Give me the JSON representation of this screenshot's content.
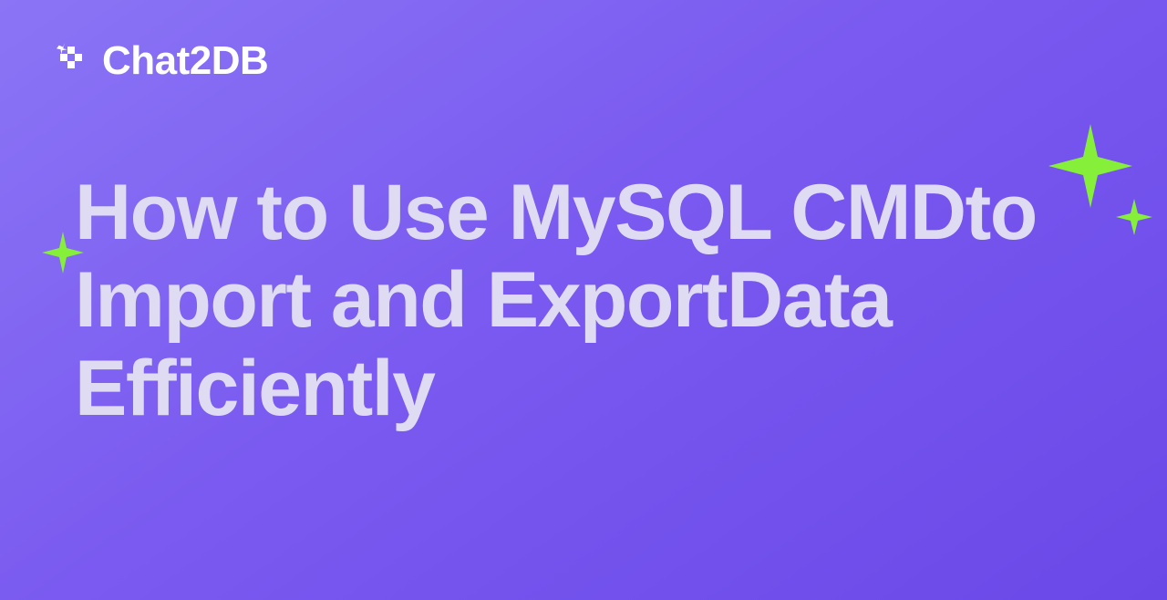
{
  "brand": {
    "name": "Chat2DB"
  },
  "headline": {
    "text": " How to Use MySQL CMDto Import and ExportData Efficiently"
  },
  "colors": {
    "sparkle": "#86ef3a",
    "text_primary": "#ffffff",
    "text_headline": "#dedbf2"
  }
}
